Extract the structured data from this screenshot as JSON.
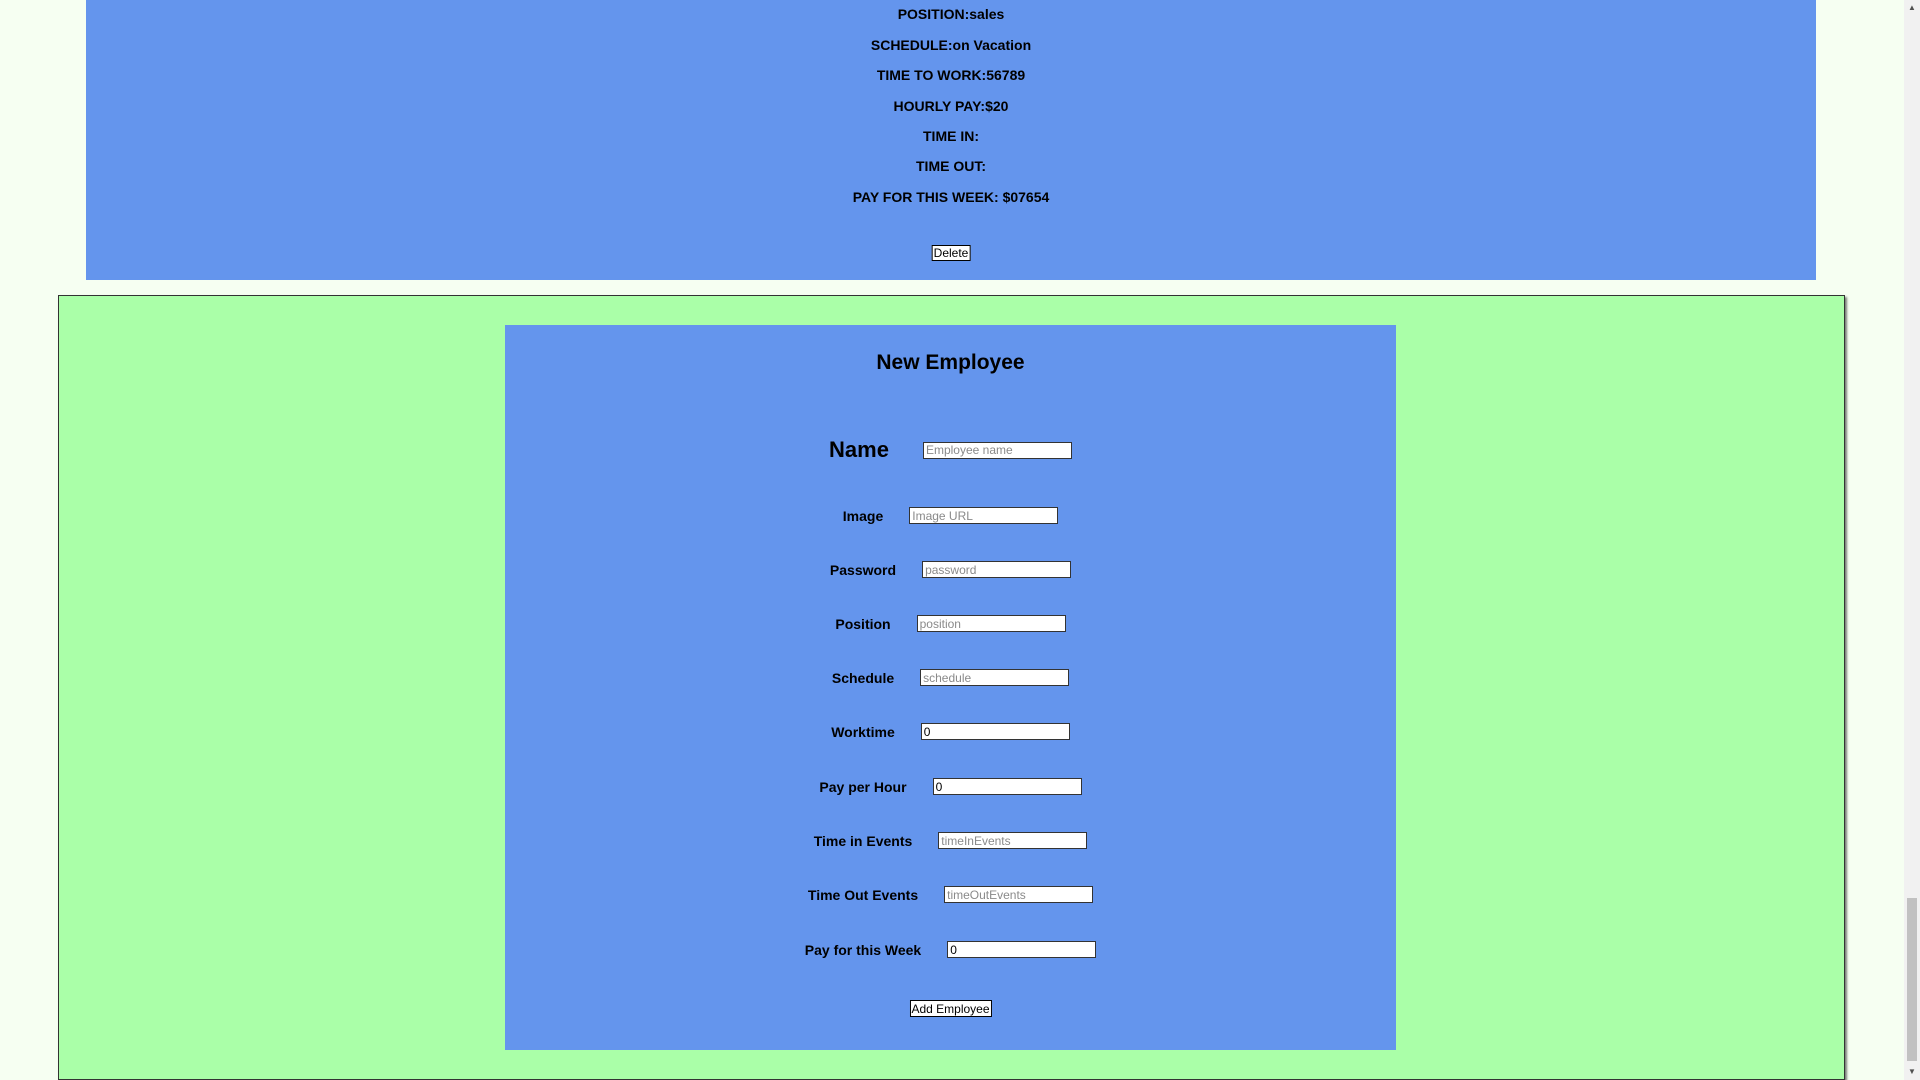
{
  "employee_card": {
    "position": "POSITION:sales",
    "schedule": "SCHEDULE:on Vacation",
    "time_to_work": "TIME TO WORK:56789",
    "hourly_pay": "HOURLY PAY:$20",
    "time_in": "TIME IN:",
    "time_out": "TIME OUT:",
    "pay_for_week": "PAY FOR THIS WEEK: $07654",
    "delete_label": "Delete"
  },
  "new_employee_form": {
    "title": "New Employee",
    "fields": {
      "name": {
        "label": "Name",
        "placeholder": "Employee name",
        "value": ""
      },
      "image": {
        "label": "Image",
        "placeholder": "Image URL",
        "value": ""
      },
      "password": {
        "label": "Password",
        "placeholder": "password",
        "value": ""
      },
      "position": {
        "label": "Position",
        "placeholder": "position",
        "value": ""
      },
      "schedule": {
        "label": "Schedule",
        "placeholder": "schedule",
        "value": ""
      },
      "worktime": {
        "label": "Worktime",
        "placeholder": "",
        "value": "0"
      },
      "pay_per_hour": {
        "label": "Pay per Hour",
        "placeholder": "",
        "value": "0"
      },
      "time_in_events": {
        "label": "Time in Events",
        "placeholder": "timeInEvents",
        "value": ""
      },
      "time_out_events": {
        "label": "Time Out Events",
        "placeholder": "timeOutEvents",
        "value": ""
      },
      "pay_for_week": {
        "label": "Pay for this Week",
        "placeholder": "",
        "value": "0"
      }
    },
    "add_label": "Add Employee"
  },
  "scrollbar": {
    "up_icon": "triangle-up",
    "down_icon": "triangle-down"
  },
  "colors": {
    "card_bg": "#6495ed",
    "section_bg": "#aaffa8",
    "page_bg": "#f6fff2"
  }
}
